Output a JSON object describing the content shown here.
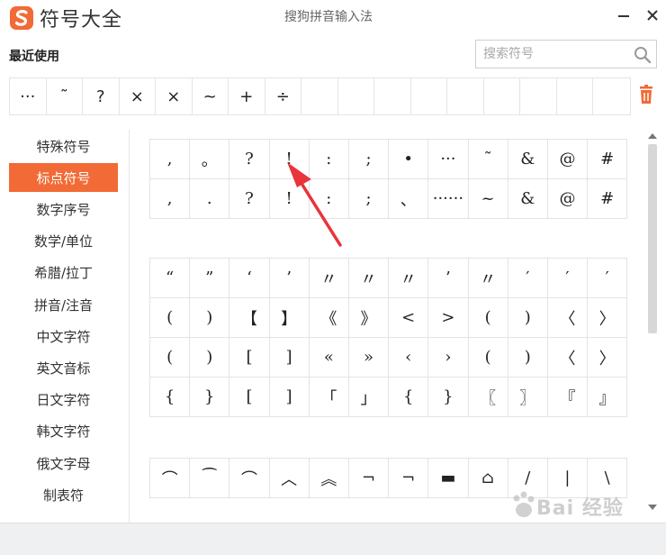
{
  "app": {
    "name": "符号大全",
    "window_title": "搜狗拼音输入法"
  },
  "colors": {
    "accent": "#f26a35",
    "annotation": "#e8343a"
  },
  "recent": {
    "label": "最近使用",
    "symbols": [
      "···",
      "˜",
      "?",
      "×",
      "×",
      "~",
      "+",
      "÷",
      "",
      "",
      "",
      "",
      "",
      "",
      "",
      "",
      ""
    ]
  },
  "search": {
    "placeholder": "搜索符号"
  },
  "sidebar": {
    "items": [
      {
        "label": "特殊符号"
      },
      {
        "label": "标点符号",
        "active": true
      },
      {
        "label": "数字序号"
      },
      {
        "label": "数学/单位"
      },
      {
        "label": "希腊/拉丁"
      },
      {
        "label": "拼音/注音"
      },
      {
        "label": "中文字符"
      },
      {
        "label": "英文音标"
      },
      {
        "label": "日文字符"
      },
      {
        "label": "韩文字符"
      },
      {
        "label": "俄文字母"
      },
      {
        "label": "制表符"
      }
    ]
  },
  "grids": [
    [
      [
        ",",
        "。",
        "?",
        "!",
        ":",
        ";",
        "•",
        "···",
        "˜",
        "&",
        "@",
        "#"
      ],
      [
        ",",
        ".",
        "?",
        "!",
        ":",
        ";",
        "、",
        "······",
        "~",
        "&",
        "@",
        "#"
      ]
    ],
    [
      [
        "“",
        "”",
        "‘",
        "’",
        "〃",
        "〃",
        "〃",
        "’",
        "〃",
        "′",
        "′",
        "′"
      ],
      [
        "(",
        ")",
        "【",
        "】",
        "《",
        "》",
        "<",
        ">",
        "(",
        ")",
        "〈",
        "〉"
      ],
      [
        "(",
        ")",
        "[",
        "]",
        "«",
        "»",
        "‹",
        "›",
        "(",
        ")",
        "〈",
        "〉"
      ],
      [
        "{",
        "}",
        "[",
        "]",
        "「",
        "」",
        "{",
        "}",
        "〖",
        "〗",
        "『",
        "』"
      ]
    ],
    [
      [
        "⌒",
        "⁀",
        "⌒",
        "︿",
        "︽",
        "¬",
        "¬",
        "▬",
        "⌂",
        "/",
        "|",
        "\\"
      ]
    ]
  ],
  "watermark": {
    "text": "Bai 经验"
  },
  "icons": {
    "logo": "sogou-s-icon",
    "minimize": "minimize-icon",
    "close": "close-icon",
    "search": "search-icon",
    "trash": "trash-icon",
    "scroll_up": "scroll-up-arrow-icon",
    "scroll_down": "scroll-down-arrow-icon"
  }
}
